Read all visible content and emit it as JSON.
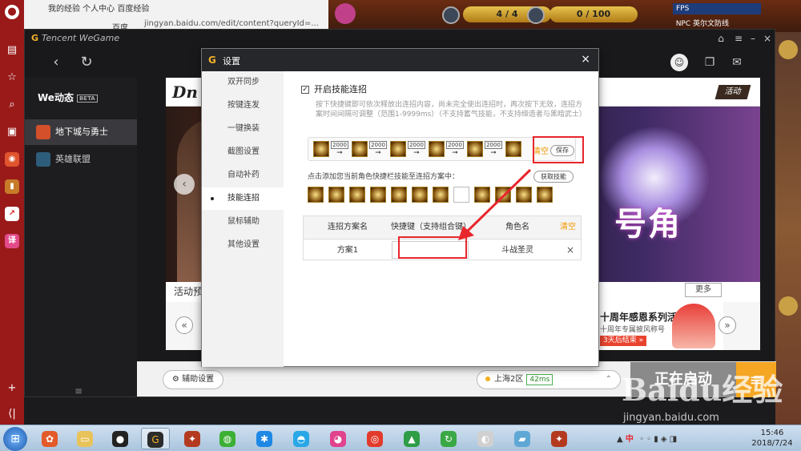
{
  "browser": {
    "tab_title": "我的经验 个人中心 百度经验",
    "tab2_title": "百度",
    "url": "jingyan.baidu.com/edit/content?queryId=..."
  },
  "game_hud": {
    "counter1": "4 / 4",
    "counter2": "0 / 100",
    "mini_label": "FPS",
    "mini2_label": "NPC 英尔文防线"
  },
  "wegame": {
    "logo_text": "Tencent WeGame",
    "brand": "We动态",
    "beta": "BETA",
    "games": [
      {
        "label": "地下城与勇士",
        "icon": "dnf-icon",
        "active": true,
        "color": "#d4502a"
      },
      {
        "label": "英雄联盟",
        "icon": "lol-icon",
        "active": false,
        "color": "#2d5d7a"
      }
    ],
    "banner": {
      "brand_text": "Dn",
      "tag": "活动",
      "title": "号角"
    },
    "activity_label": "活动预",
    "more": "更多",
    "promo": {
      "title": "十周年感恩系列活动",
      "subtitle": "十周年专属披风称号",
      "ends": "3天后结束 »"
    },
    "bottom": {
      "assist": "辅助设置",
      "server": "上海2区",
      "ping": "42ms",
      "launch": "正在启动",
      "menu": "≡"
    }
  },
  "dialog": {
    "title": "设置",
    "close": "×",
    "nav": [
      "双开同步",
      "按键连发",
      "一键换装",
      "截图设置",
      "自动补药",
      "技能连招",
      "鼠标辅助",
      "其他设置"
    ],
    "active_index": 5,
    "enable_label": "开启技能连招",
    "enable_checked": true,
    "help": "按下快捷键即可依次释放出连招内容，尚未完全使出连招时，再次按下无效，连招方案时间间隔可调整（范围1-9999ms）（不支持蓄气技能，不支持缔造者与黑暗武士）",
    "combo_intervals": [
      "2000",
      "2000",
      "2000",
      "2000",
      "2000"
    ],
    "combo_clear": "清空",
    "save": "保存",
    "add_hint": "点击添加您当前角色快捷栏技能至连招方案中：",
    "fetch": "获取技能",
    "table": {
      "headers": [
        "连招方案名",
        "快捷键（支持组合键）",
        "角色名"
      ],
      "clear": "清空",
      "rows": [
        {
          "name": "方案1",
          "hotkey": "",
          "role": "斗战圣灵",
          "delete": "×"
        }
      ]
    }
  },
  "taskbar": {
    "tray_ime": "中",
    "time": "15:46",
    "date": "2018/7/24"
  },
  "watermark": {
    "main": "Baidu经验",
    "sub": "jingyan.baidu.com"
  },
  "colors": {
    "accent": "#f39800",
    "annotation": "#e8262c",
    "dialog_header": "#26272b"
  }
}
